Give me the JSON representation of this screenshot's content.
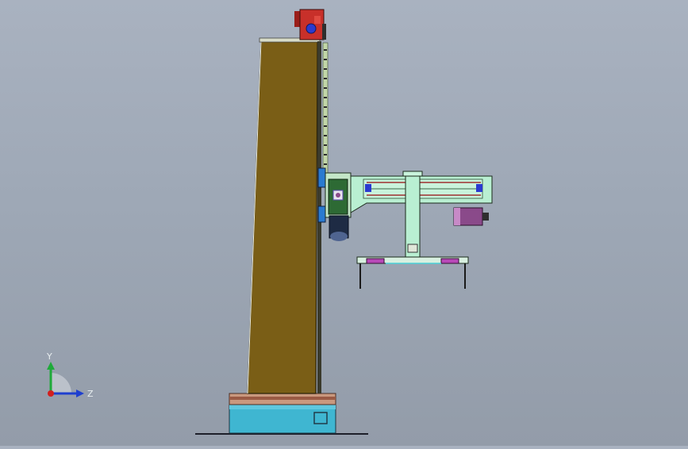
{
  "viewport": {
    "background_top": "#a9b2c0",
    "background_bottom": "#939ca9"
  },
  "model": {
    "column_color": "#7a5e16",
    "base_ring_color": "#c9987e",
    "base_drum_color": "#3fb6d1",
    "gearbox_color": "#c8302a",
    "arm_color": "#b9efd2",
    "motor_color": "#8a4a8a"
  },
  "triad": {
    "y_label": "Y",
    "z_label": "Z",
    "y_color": "#1faa3a",
    "z_color": "#1f3fcf",
    "x_color": "#d21f1f"
  }
}
